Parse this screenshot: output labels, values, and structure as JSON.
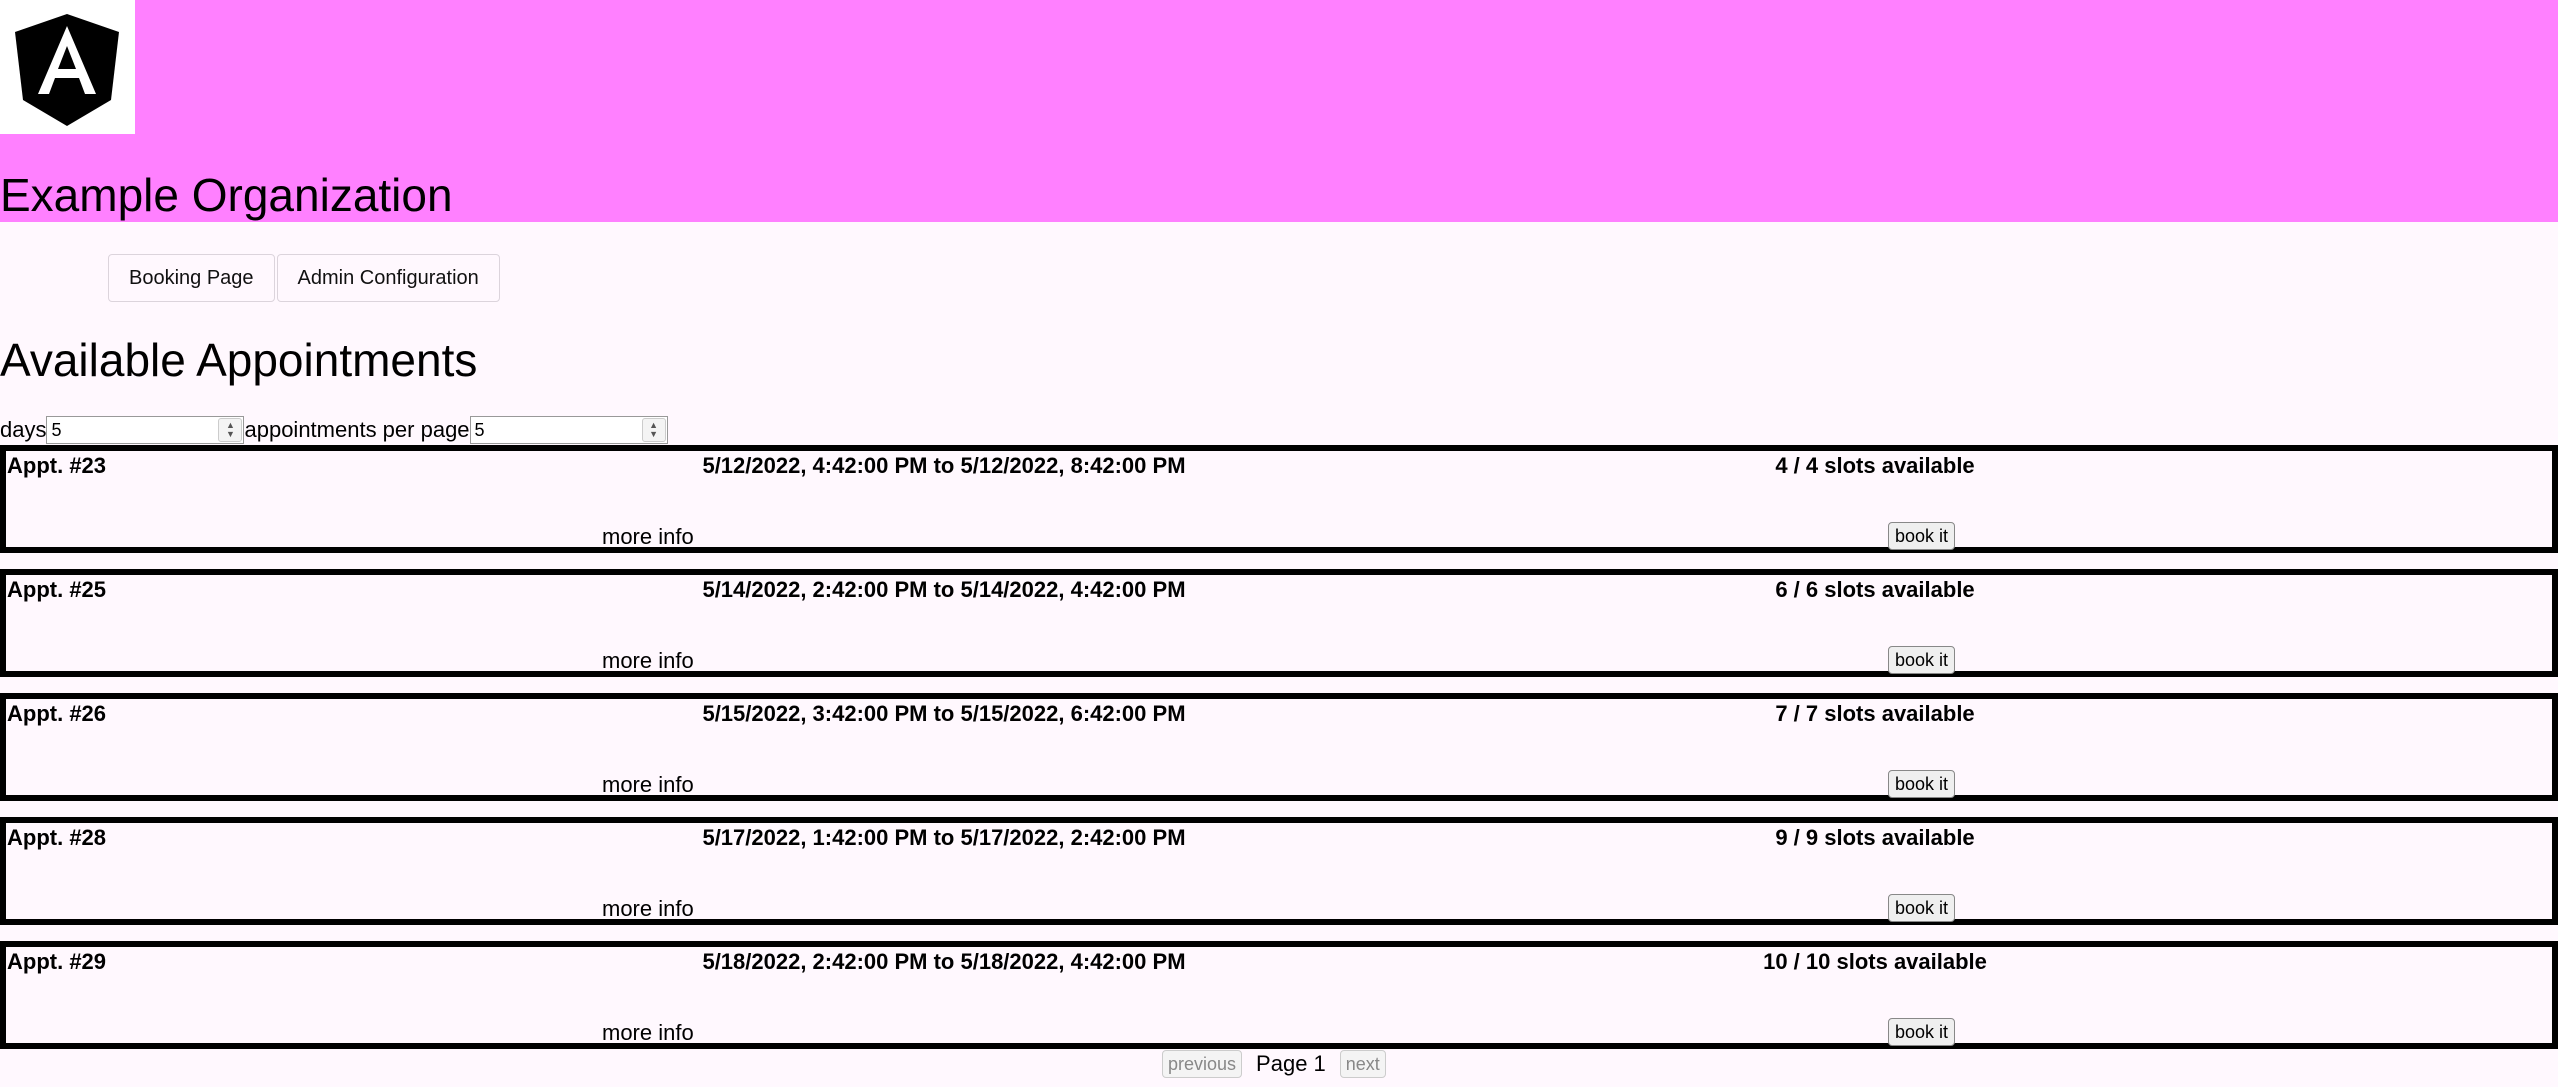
{
  "header": {
    "org_name": "Example Organization"
  },
  "nav": {
    "items": [
      {
        "label": "Booking Page"
      },
      {
        "label": "Admin Configuration"
      }
    ]
  },
  "main": {
    "heading": "Available Appointments",
    "days_label": "days",
    "days_value": "5",
    "per_page_label": "appointments per page",
    "per_page_value": "5"
  },
  "appointments": [
    {
      "id": "Appt. #23",
      "time": "5/12/2022, 4:42:00 PM to 5/12/2022, 8:42:00 PM",
      "slots": "4 / 4 slots available",
      "more": "more info",
      "book": "book it"
    },
    {
      "id": "Appt. #25",
      "time": "5/14/2022, 2:42:00 PM to 5/14/2022, 4:42:00 PM",
      "slots": "6 / 6 slots available",
      "more": "more info",
      "book": "book it"
    },
    {
      "id": "Appt. #26",
      "time": "5/15/2022, 3:42:00 PM to 5/15/2022, 6:42:00 PM",
      "slots": "7 / 7 slots available",
      "more": "more info",
      "book": "book it"
    },
    {
      "id": "Appt. #28",
      "time": "5/17/2022, 1:42:00 PM to 5/17/2022, 2:42:00 PM",
      "slots": "9 / 9 slots available",
      "more": "more info",
      "book": "book it"
    },
    {
      "id": "Appt. #29",
      "time": "5/18/2022, 2:42:00 PM to 5/18/2022, 4:42:00 PM",
      "slots": "10 / 10 slots available",
      "more": "more info",
      "book": "book it"
    }
  ],
  "pager": {
    "previous": "previous",
    "page": "Page 1",
    "next": "next"
  },
  "colors": {
    "header_bg": "#ff80ff",
    "page_bg": "#fff8fe"
  },
  "icons": {
    "logo": "angular-logo-icon"
  }
}
